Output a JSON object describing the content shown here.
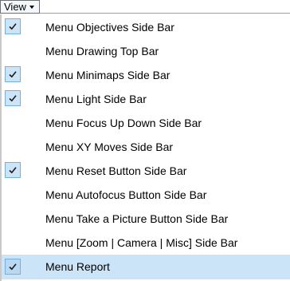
{
  "menubar": {
    "view_label": "View"
  },
  "menu": {
    "items": [
      {
        "label": "Menu Objectives Side Bar",
        "checked": true
      },
      {
        "label": "Menu Drawing Top Bar",
        "checked": false
      },
      {
        "label": "Menu Minimaps Side Bar",
        "checked": true
      },
      {
        "label": "Menu Light Side Bar",
        "checked": true
      },
      {
        "label": "Menu Focus Up Down Side Bar",
        "checked": false
      },
      {
        "label": "Menu XY Moves Side Bar",
        "checked": false
      },
      {
        "label": "Menu Reset Button Side Bar",
        "checked": true
      },
      {
        "label": "Menu Autofocus Button Side Bar",
        "checked": false
      },
      {
        "label": "Menu Take a Picture Button Side Bar",
        "checked": false
      },
      {
        "label": "Menu [Zoom | Camera | Misc] Side Bar",
        "checked": false
      },
      {
        "label": "Menu Report",
        "checked": true,
        "highlighted": true
      }
    ]
  },
  "colors": {
    "highlight": "#cce4f7",
    "check_border": "#76aee0"
  }
}
